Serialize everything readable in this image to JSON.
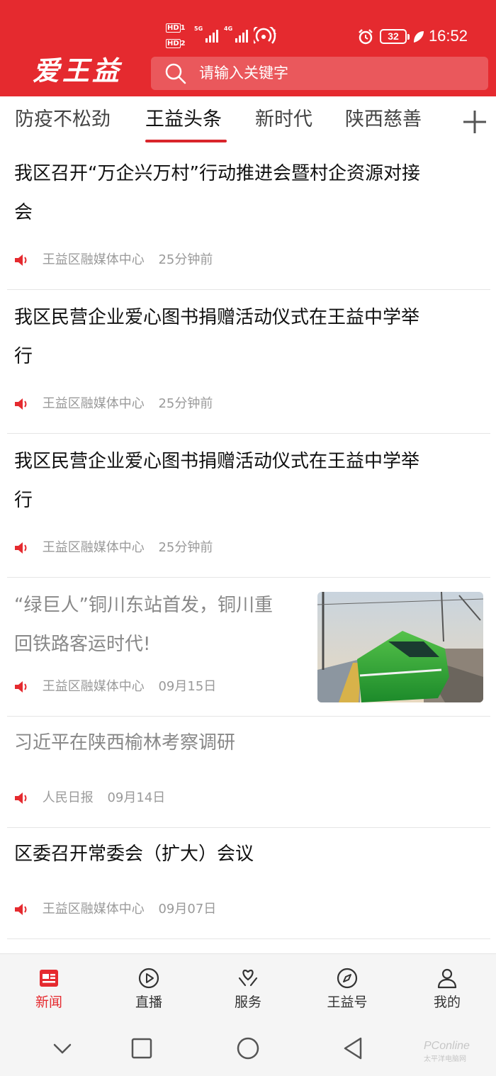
{
  "status_bar": {
    "hd1": "HD",
    "hd1_num": "1",
    "hd2": "HD",
    "hd2_num": "2",
    "net1": "5G",
    "net2": "4G",
    "hotspot_num": "1",
    "battery": "32",
    "time": "16:52"
  },
  "header": {
    "logo": "爱王益",
    "search_placeholder": "请输入关键字"
  },
  "tabs": [
    {
      "label": "防疫不松劲",
      "active": false
    },
    {
      "label": "王益头条",
      "active": true
    },
    {
      "label": "新时代",
      "active": false
    },
    {
      "label": "陕西慈善",
      "active": false
    }
  ],
  "news": [
    {
      "title_line1": "我区召开“万企兴万村”行动推进会暨村企资源对接",
      "title_line2": "会",
      "source": "王益区融媒体中心",
      "time": "25分钟前"
    },
    {
      "title_line1": "我区民营企业爱心图书捐赠活动仪式在王益中学举",
      "title_line2": "行",
      "source": "王益区融媒体中心",
      "time": "25分钟前"
    },
    {
      "title_line1": "我区民营企业爱心图书捐赠活动仪式在王益中学举",
      "title_line2": "行",
      "source": "王益区融媒体中心",
      "time": "25分钟前"
    },
    {
      "title_line1": "“绿巨人”铜川东站首发，铜川重",
      "title_line2": "回铁路客运时代!",
      "source": "王益区融媒体中心",
      "time": "09月15日"
    },
    {
      "title_line1": "习近平在陕西榆林考察调研",
      "source": "人民日报",
      "time": "09月14日"
    },
    {
      "title_line1": "区委召开常委会（扩大）会议",
      "source": "王益区融媒体中心",
      "time": "09月07日"
    }
  ],
  "bottom_nav": [
    {
      "label": "新闻",
      "icon": "news-icon",
      "active": true
    },
    {
      "label": "直播",
      "icon": "play-icon",
      "active": false
    },
    {
      "label": "服务",
      "icon": "service-icon",
      "active": false
    },
    {
      "label": "王益号",
      "icon": "compass-icon",
      "active": false
    },
    {
      "label": "我的",
      "icon": "user-icon",
      "active": false
    }
  ],
  "watermark": {
    "brand": "PConline",
    "sub": "太平洋电脑网"
  },
  "colors": {
    "brand_red": "#e52a2f",
    "text_gray": "#9a9a9a"
  }
}
